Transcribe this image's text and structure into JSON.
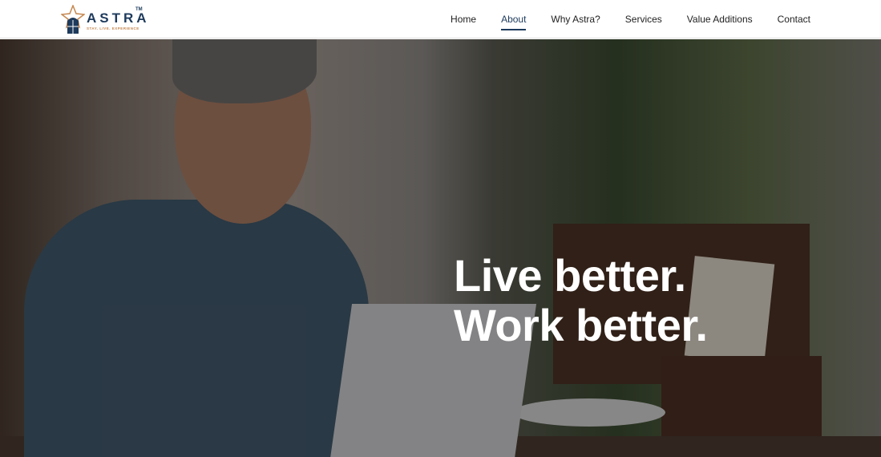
{
  "header": {
    "logo": {
      "name": "ASTRA",
      "trademark": "TM",
      "tagline": "STAY. LIVE. EXPERIENCE"
    },
    "nav": [
      {
        "label": "Home",
        "active": false
      },
      {
        "label": "About",
        "active": true
      },
      {
        "label": "Why Astra?",
        "active": false
      },
      {
        "label": "Services",
        "active": false
      },
      {
        "label": "Value Additions",
        "active": false
      },
      {
        "label": "Contact",
        "active": false
      }
    ]
  },
  "hero": {
    "headline_line1": "Live better.",
    "headline_line2": "Work better."
  },
  "colors": {
    "brand_navy": "#1d3a5c",
    "brand_copper": "#c5874f"
  }
}
